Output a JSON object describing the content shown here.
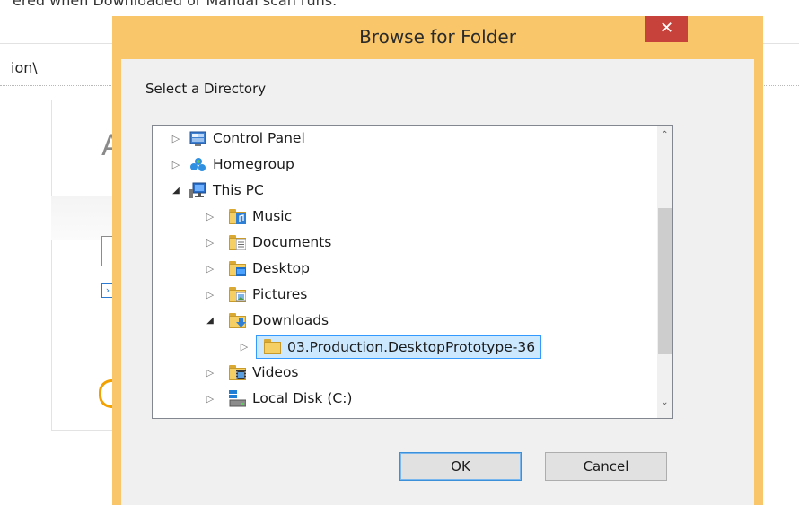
{
  "background": {
    "top_text": "ered when Downloaded or Manual scan runs.",
    "path_fragment": "ion\\",
    "card_letter": "A",
    "card_close_glyph": "×"
  },
  "dialog": {
    "title": "Browse for Folder",
    "close_glyph": "✕",
    "prompt": "Select a Directory",
    "tree": [
      {
        "label": "Control Panel",
        "icon": "control-panel-icon",
        "expander": "collapsed",
        "level": 0
      },
      {
        "label": "Homegroup",
        "icon": "homegroup-icon",
        "expander": "collapsed",
        "level": 0
      },
      {
        "label": "This PC",
        "icon": "computer-icon",
        "expander": "expanded",
        "level": 0
      },
      {
        "label": "Music",
        "icon": "music-folder-icon",
        "expander": "collapsed",
        "level": 1
      },
      {
        "label": "Documents",
        "icon": "documents-folder-icon",
        "expander": "collapsed",
        "level": 1
      },
      {
        "label": "Desktop",
        "icon": "desktop-folder-icon",
        "expander": "collapsed",
        "level": 1
      },
      {
        "label": "Pictures",
        "icon": "pictures-folder-icon",
        "expander": "collapsed",
        "level": 1
      },
      {
        "label": "Downloads",
        "icon": "downloads-folder-icon",
        "expander": "expanded",
        "level": 1
      },
      {
        "label": "03.Production.DesktopPrototype-36",
        "icon": "folder-icon",
        "expander": "collapsed",
        "level": 2,
        "selected": true
      },
      {
        "label": "Videos",
        "icon": "videos-folder-icon",
        "expander": "collapsed",
        "level": 1
      },
      {
        "label": "Local Disk (C:)",
        "icon": "local-disk-icon",
        "expander": "collapsed",
        "level": 1
      }
    ],
    "scroll_up_glyph": "⌃",
    "scroll_down_glyph": "⌄",
    "ok_label": "OK",
    "cancel_label": "Cancel"
  },
  "colors": {
    "dialog_frame": "#f9c76a",
    "close_button": "#c7423a",
    "selection_fill": "#cce8ff",
    "selection_border": "#3399ff"
  }
}
